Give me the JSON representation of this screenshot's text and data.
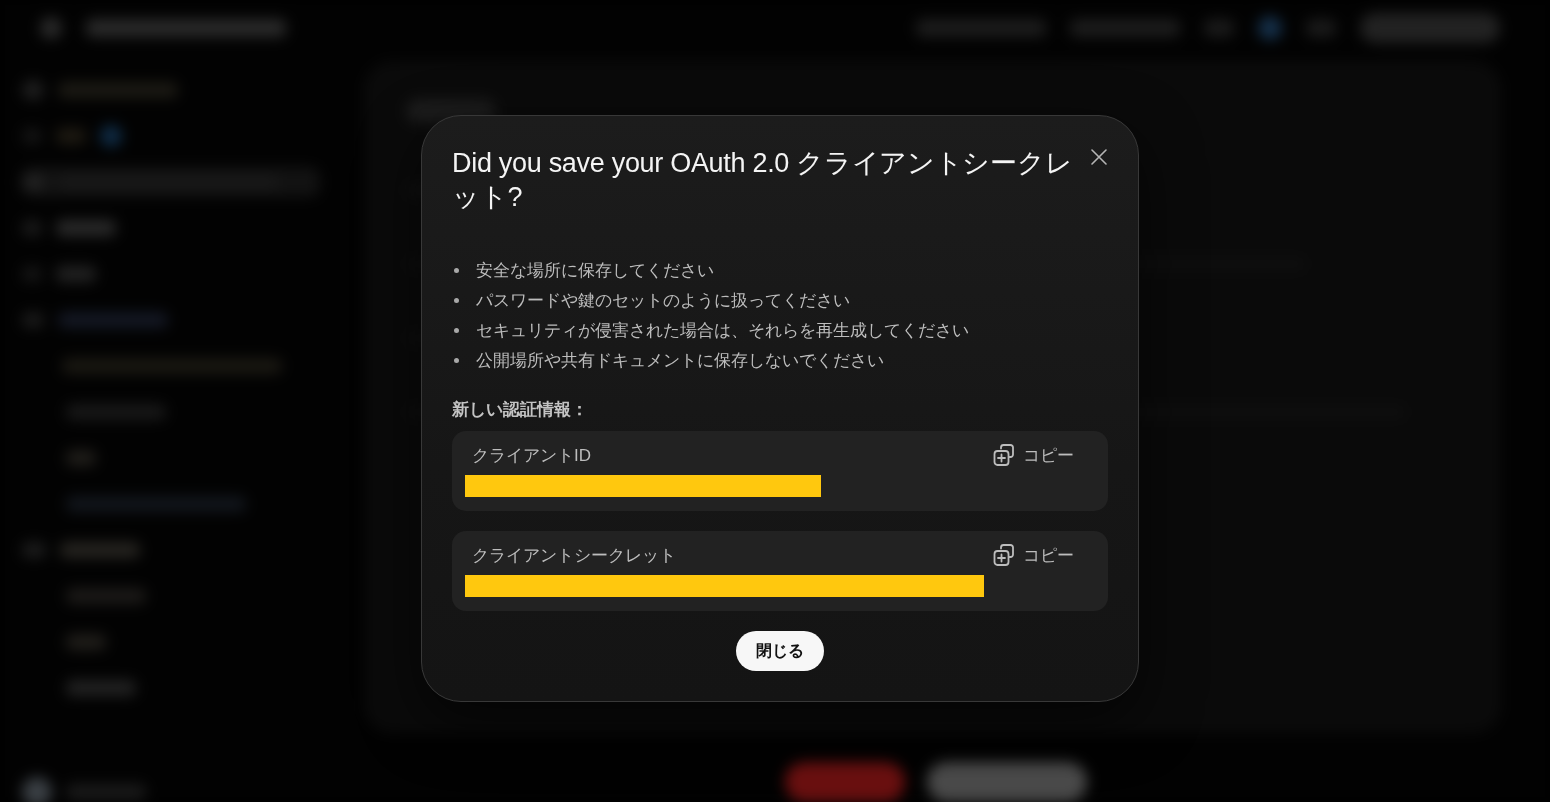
{
  "dialog": {
    "title": "Did you save your OAuth 2.0 クライアントシークレット?",
    "tips": [
      "安全な場所に保存してください",
      "パスワードや鍵のセットのように扱ってください",
      "セキュリティが侵害された場合は、それらを再生成してください",
      "公開場所や共有ドキュメントに保存しないでください"
    ],
    "credentials_heading": "新しい認証情報：",
    "credentials": [
      {
        "label": "クライアントID",
        "copy_label": "コピー",
        "redacted": true
      },
      {
        "label": "クライアントシークレット",
        "copy_label": "コピー",
        "redacted": true
      }
    ],
    "close_button": "閉じる"
  }
}
